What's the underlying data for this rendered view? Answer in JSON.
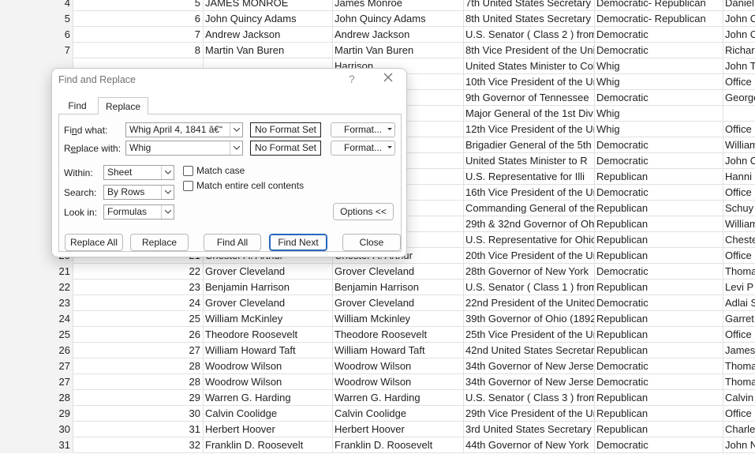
{
  "sheet": {
    "rows": [
      [
        "4",
        "5",
        "JAMES MONROE",
        "James Monroe",
        "7th  United States Secretary",
        "Democratic-  Republican",
        "Daniel"
      ],
      [
        "5",
        "6",
        "John Quincy Adams",
        "John Quincy Adams",
        "8th  United States Secretary",
        "Democratic-  Republican",
        "John C"
      ],
      [
        "6",
        "7",
        "Andrew Jackson",
        "Andrew Jackson",
        "U.S. Senator  ( Class 2 )  from",
        "Democratic",
        "John C"
      ],
      [
        "7",
        "8",
        "Martin Van Buren",
        "Martin Van Buren",
        "8th  Vice President of the Uni",
        "Democratic",
        "Richard"
      ],
      [
        "",
        "",
        "",
        "Harrison",
        "United States Minister to Col",
        "Whig",
        "John T"
      ],
      [
        "",
        "",
        "",
        "",
        "10th  Vice President of the Un",
        "Whig",
        "Office"
      ],
      [
        "",
        "",
        "",
        "",
        "9th  Governor of Tennessee",
        "Democratic",
        "George"
      ],
      [
        "",
        "",
        "",
        "",
        "Major General  of the  1st  Div",
        "Whig",
        ""
      ],
      [
        "",
        "",
        "",
        "e",
        "12th  Vice President of the Un",
        "Whig",
        "Office"
      ],
      [
        "",
        "",
        "",
        "",
        "Brigadier General  of the  5th",
        "Democratic",
        "William"
      ],
      [
        "",
        "",
        "",
        "an",
        "United States Minister  to  R",
        "Democratic",
        "John C"
      ],
      [
        "",
        "",
        "",
        "ln",
        "U.S. Representative  for  Illi",
        "Republican",
        "Hanni"
      ],
      [
        "",
        "",
        "",
        "n",
        "16th  Vice President of the Un",
        "Democratic",
        "Office"
      ],
      [
        "",
        "",
        "",
        "t",
        "Commanding General  of the",
        "Republican",
        "Schuy"
      ],
      [
        "",
        "",
        "",
        "Hayes",
        "29th & 32nd  Governor of Ohio",
        "Republican",
        "William"
      ],
      [
        "",
        "",
        "",
        "eld",
        "U.S. Representative  for  Ohio",
        "Republican",
        "Chester"
      ],
      [
        "20",
        "21",
        "Chester A. Arthur",
        "Chester A. Arthur",
        "20th  Vice President of the Un",
        "Republican",
        "Office"
      ],
      [
        "21",
        "22",
        "Grover Cleveland",
        "Grover Cleveland",
        "28th  Governor of New York",
        "Democratic",
        "Thomas"
      ],
      [
        "22",
        "23",
        "Benjamin Harrison",
        "Benjamin Harrison",
        "U.S. Senator  ( Class 1 )  from",
        "Republican",
        "Levi P"
      ],
      [
        "23",
        "24",
        "Grover Cleveland",
        "Grover Cleveland",
        "22nd  President of the United",
        "Democratic",
        "Adlai S"
      ],
      [
        "24",
        "25",
        "William McKinley",
        "William Mckinley",
        "39th  Governor of Ohio  (1892",
        "Republican",
        "Garret"
      ],
      [
        "25",
        "26",
        "Theodore Roosevelt",
        "Theodore Roosevelt",
        "25th  Vice President of the Un",
        "Republican",
        "Office"
      ],
      [
        "26",
        "27",
        "William Howard Taft",
        "William Howard Taft",
        "42nd  United States Secretary",
        "Republican",
        "James"
      ],
      [
        "27",
        "28",
        "Woodrow Wilson",
        "Woodrow Wilson",
        "34th  Governor of New Jersey",
        "Democratic",
        "Thomas"
      ],
      [
        "27",
        "28",
        "Woodrow Wilson",
        "Woodrow Wilson",
        "34th  Governor of New Jersey",
        "Democratic",
        "Thomas"
      ],
      [
        "28",
        "29",
        "Warren G. Harding",
        "Warren G. Harding",
        "U.S. Senator  ( Class 3 )  from",
        "Republican",
        "Calvin"
      ],
      [
        "29",
        "30",
        "Calvin Coolidge",
        "Calvin Coolidge",
        "29th  Vice President of the Un",
        "Republican",
        "Office"
      ],
      [
        "30",
        "31",
        "Herbert Hoover",
        "Herbert Hoover",
        "3rd  United States Secretary",
        "Republican",
        "Charles"
      ],
      [
        "31",
        "32",
        "Franklin D. Roosevelt",
        "Franklin D. Roosevelt",
        "44th  Governor of New York",
        "Democratic",
        "John N"
      ]
    ]
  },
  "dialog": {
    "title": "Find and Replace",
    "help": "?",
    "tabs": {
      "find": "Find",
      "replace": "Replace"
    },
    "find_what": {
      "label_pre": "Fi",
      "label_key": "n",
      "label_post": "d what:",
      "value": "Whig   April 4, 1841  â€“",
      "format_status": "No Format Set",
      "format_btn": "Format...",
      "format_btn_key": "M"
    },
    "replace_with": {
      "label_pre": "R",
      "label_key": "e",
      "label_post": "place with:",
      "value": "Whig",
      "format_status": "No Format Set",
      "format_btn": "Format..."
    },
    "within": {
      "label": "Within:",
      "value": "Sheet"
    },
    "search": {
      "label": "Search:",
      "value": "By Rows"
    },
    "look_in": {
      "label": "Look in:",
      "value": "Formulas"
    },
    "match_case": {
      "label": "Match case",
      "checked": false
    },
    "match_entire": {
      "label": "Match entire cell contents",
      "checked": false
    },
    "options_btn": "Options <<",
    "buttons": {
      "replace_all": "Replace All",
      "replace": "Replace",
      "find_all": "Find All",
      "find_next": "Find Next",
      "close": "Close"
    }
  },
  "colors": {
    "gridline": "#e1e1e1",
    "focus_blue": "#2565c0",
    "dialog_border": "#c8c8c8"
  }
}
